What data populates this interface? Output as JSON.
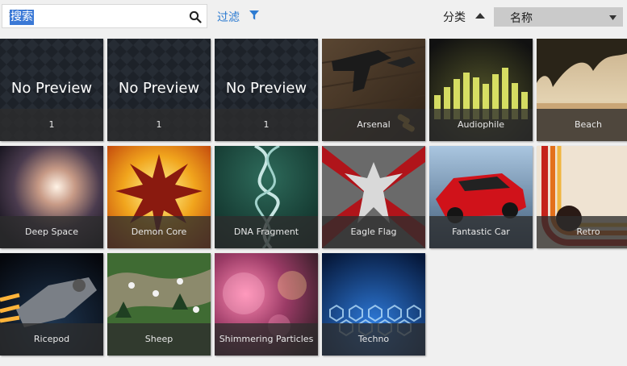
{
  "search": {
    "value": "",
    "placeholder": "搜索",
    "selected_text": "搜索",
    "icon": "search-icon"
  },
  "filter": {
    "label": "过滤",
    "icon": "filter-icon"
  },
  "sort": {
    "label": "分类",
    "direction_icon": "sort-ascending-icon",
    "selected": "名称"
  },
  "colors": {
    "accent": "#2d7bd1",
    "background": "#f0f0f0",
    "caption_bg": "#2d2d2d",
    "select_bg": "#cacaca"
  },
  "tiles": [
    {
      "preview": "No Preview",
      "label": "1"
    },
    {
      "preview": "No Preview",
      "label": "1"
    },
    {
      "preview": "No Preview",
      "label": "1"
    },
    {
      "label": "Arsenal"
    },
    {
      "label": "Audiophile"
    },
    {
      "label": "Beach"
    },
    {
      "label": "Deep Space"
    },
    {
      "label": "Demon Core"
    },
    {
      "label": "DNA Fragment"
    },
    {
      "label": "Eagle Flag"
    },
    {
      "label": "Fantastic Car"
    },
    {
      "label": "Retro"
    },
    {
      "label": "Ricepod"
    },
    {
      "label": "Sheep"
    },
    {
      "label": "Shimmering Particles"
    },
    {
      "label": "Techno"
    }
  ]
}
